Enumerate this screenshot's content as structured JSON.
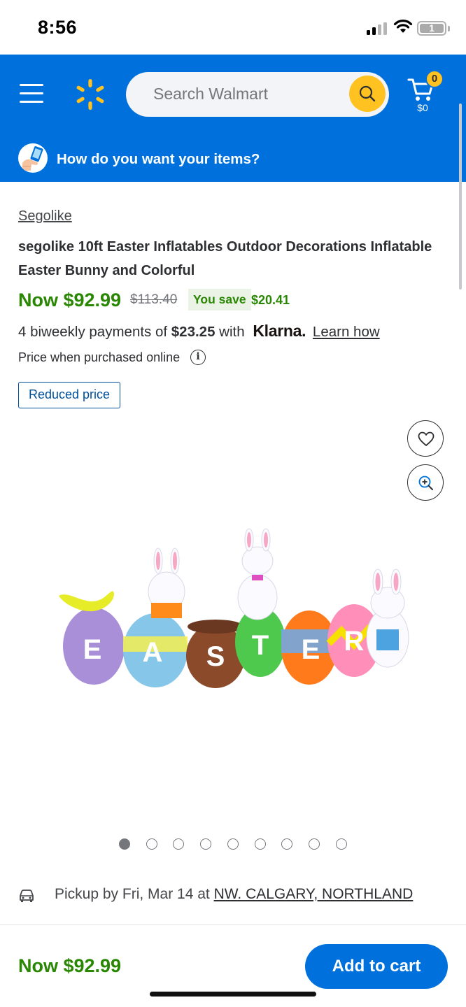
{
  "status_bar": {
    "time": "8:56",
    "battery_level": "1"
  },
  "header": {
    "search_placeholder": "Search Walmart",
    "cart_count": "0",
    "cart_total": "$0",
    "delivery_prompt": "How do you want your items?",
    "colors": {
      "header_bg": "#0071dc",
      "spark": "#ffc220"
    }
  },
  "product": {
    "brand": "Segolike",
    "title": "segolike 10ft Easter Inflatables Outdoor Decorations Inflatable Easter Bunny and Colorful",
    "now_price": "Now $92.99",
    "was_price": "$113.40",
    "you_save_label": "You save",
    "save_amount": "$20.41",
    "klarna_prefix": "4 biweekly payments of ",
    "klarna_amount": "$23.25",
    "klarna_with": " with ",
    "klarna_brand": "Klarna.",
    "learn_how": "Learn how",
    "price_note": "Price when purchased online",
    "badge": "Reduced price",
    "image_letters": [
      "E",
      "A",
      "S",
      "T",
      "E",
      "R"
    ],
    "image_count": 9,
    "active_image": 1
  },
  "pickup": {
    "prefix": "Pickup by Fri, Mar 14 at ",
    "store": "NW. CALGARY, NORTHLAND"
  },
  "footer": {
    "price": "Now $92.99",
    "add_to_cart": "Add to cart"
  },
  "colors": {
    "price_green": "#2a8703",
    "button_blue": "#0071dc"
  }
}
